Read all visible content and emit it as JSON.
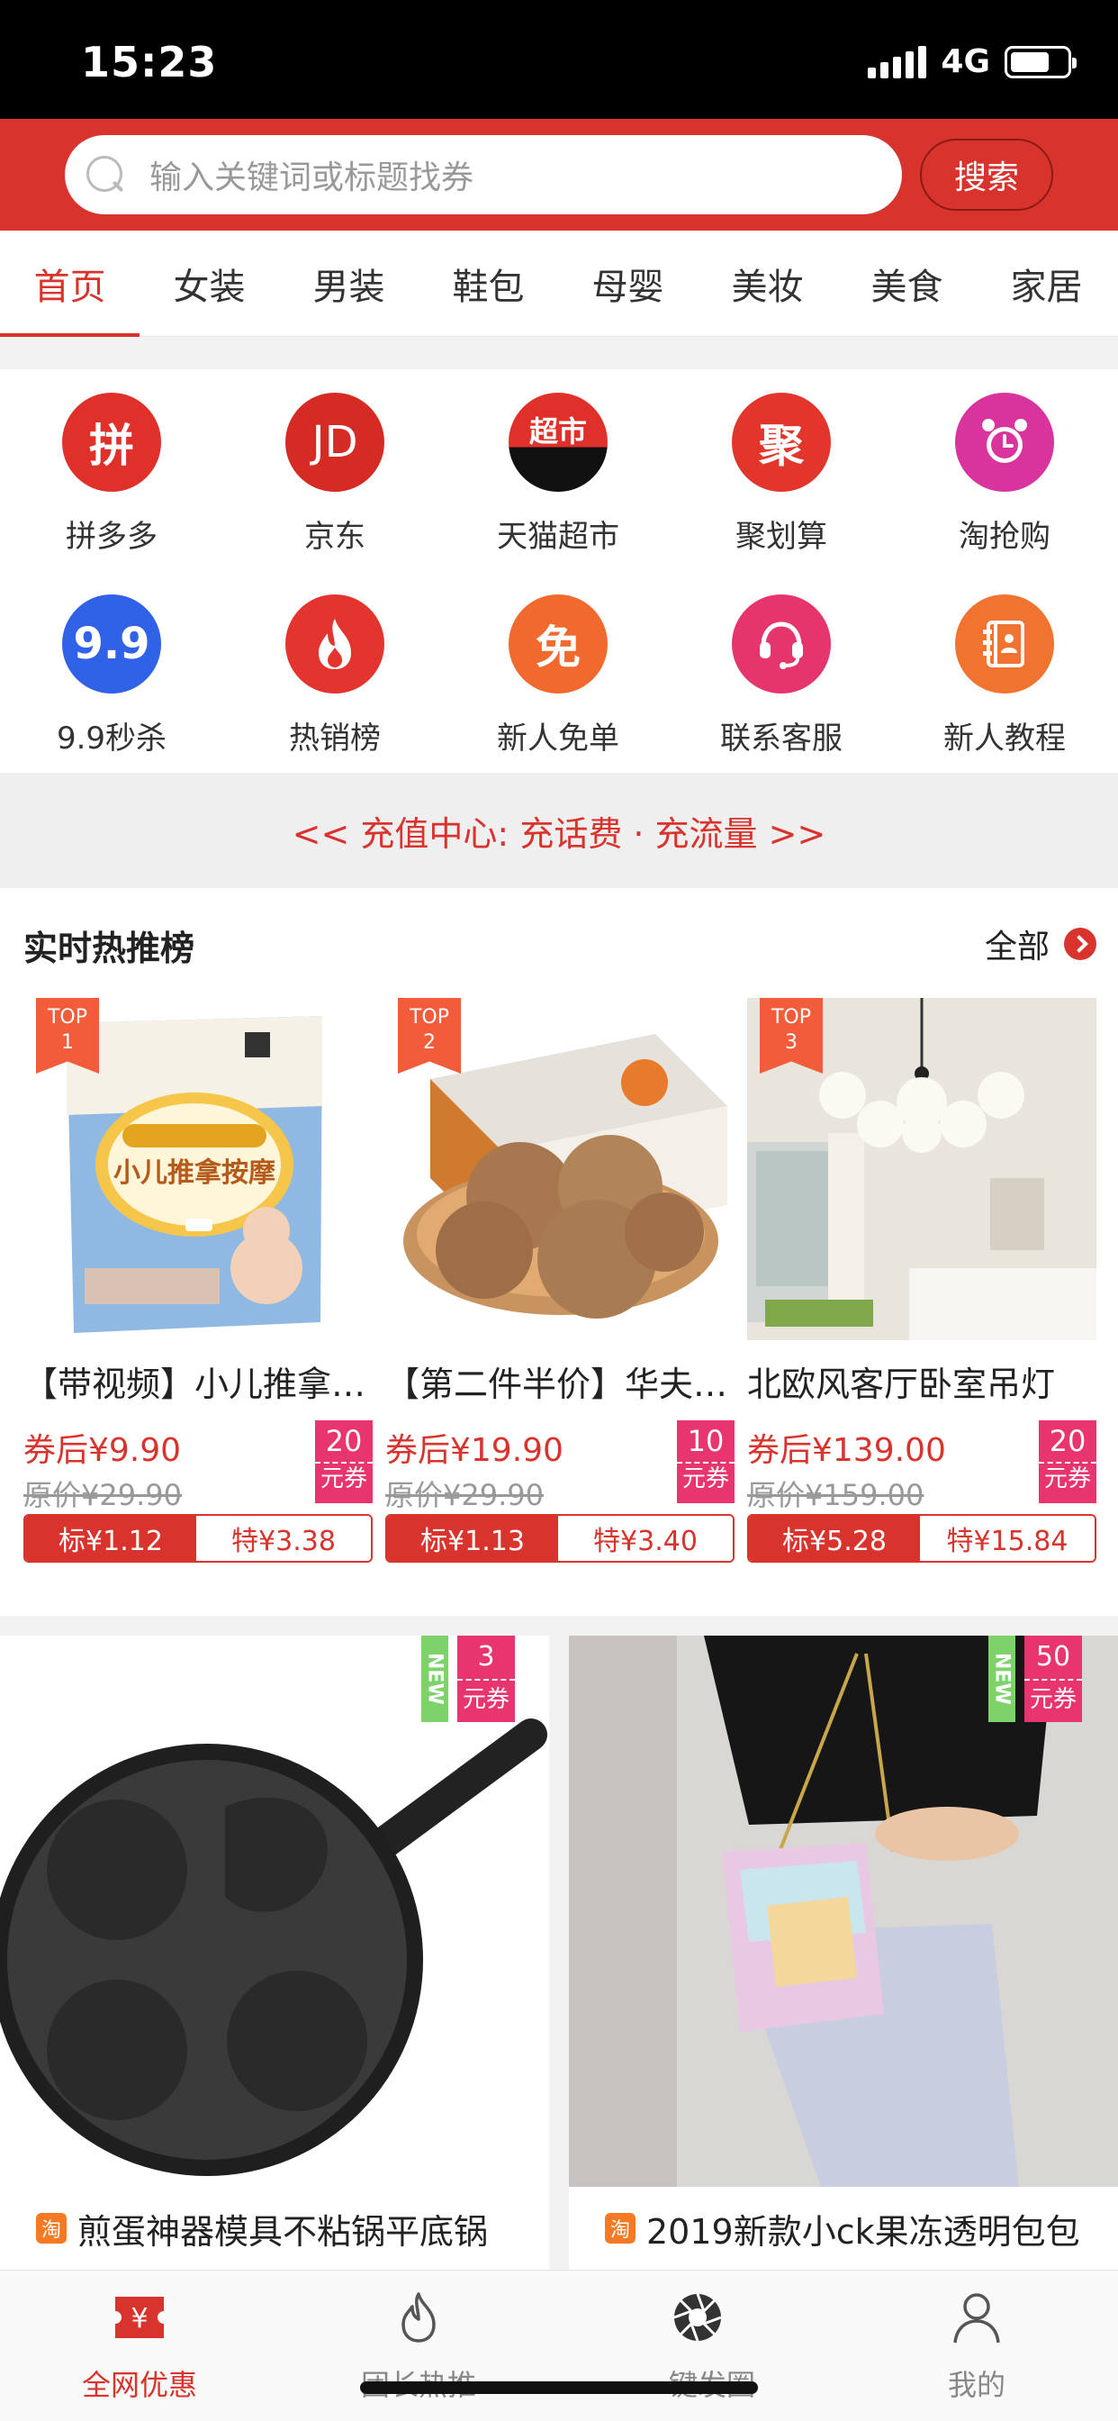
{
  "status_bar": {
    "time": "15:23",
    "network": "4G",
    "battery_level": 0.7
  },
  "search": {
    "placeholder": "输入关键词或标题找券",
    "button_label": "搜索"
  },
  "categories": [
    "首页",
    "女装",
    "男装",
    "鞋包",
    "母婴",
    "美妆",
    "美食",
    "家居"
  ],
  "active_category": "首页",
  "shortcuts": [
    {
      "label": "拼多多",
      "icon": "pinduoduo-icon",
      "glyph": "拼",
      "color": "#e0302a"
    },
    {
      "label": "京东",
      "icon": "jd-icon",
      "glyph": "JD",
      "color": "#d62a25"
    },
    {
      "label": "天猫超市",
      "icon": "tmall-supermarket-icon",
      "glyph": "超市",
      "color": "#111111"
    },
    {
      "label": "聚划算",
      "icon": "juhuasuan-icon",
      "glyph": "聚",
      "color": "#e2362c"
    },
    {
      "label": "淘抢购",
      "icon": "alarm-clock-icon",
      "glyph": "⏰",
      "color": "#d9339e"
    },
    {
      "label": "9.9秒杀",
      "icon": "nine-nine-icon",
      "glyph": "9.9",
      "color": "#2f62e6"
    },
    {
      "label": "热销榜",
      "icon": "flame-icon",
      "glyph": "🔥",
      "color": "#e3352d"
    },
    {
      "label": "新人免单",
      "icon": "free-order-icon",
      "glyph": "免",
      "color": "#f0692d"
    },
    {
      "label": "联系客服",
      "icon": "customer-service-icon",
      "glyph": "☏",
      "color": "#e6356c"
    },
    {
      "label": "新人教程",
      "icon": "tutorial-book-icon",
      "glyph": "📔",
      "color": "#f07430"
    }
  ],
  "recharge_banner": "<< 充值中心: 充话费 · 充流量 >>",
  "hot_rank": {
    "title": "实时热推榜",
    "all_label": "全部",
    "items": [
      {
        "rank_label": "TOP",
        "rank": "1",
        "name": "【带视频】小儿推拿按摩",
        "after_price": "券后¥9.90",
        "original_price": "原价¥29.90",
        "coupon_amount": "20",
        "coupon_unit": "元券",
        "commission_standard": "标¥1.12",
        "commission_special": "特¥3.38"
      },
      {
        "rank_label": "TOP",
        "rank": "2",
        "name": "【第二件半价】华夫饼干",
        "after_price": "券后¥19.90",
        "original_price": "原价¥29.90",
        "coupon_amount": "10",
        "coupon_unit": "元券",
        "commission_standard": "标¥1.13",
        "commission_special": "特¥3.40"
      },
      {
        "rank_label": "TOP",
        "rank": "3",
        "name": "北欧风客厅卧室吊灯",
        "after_price": "券后¥139.00",
        "original_price": "原价¥159.00",
        "coupon_amount": "20",
        "coupon_unit": "元券",
        "commission_standard": "标¥5.28",
        "commission_special": "特¥15.84"
      }
    ]
  },
  "feed": [
    {
      "new_label": "NEW",
      "coupon_amount": "3",
      "coupon_unit": "元券",
      "platform_icon": "淘",
      "title": "煎蛋神器模具不粘锅平底锅"
    },
    {
      "new_label": "NEW",
      "coupon_amount": "50",
      "coupon_unit": "元券",
      "platform_icon": "淘",
      "title": "2019新款小ck果冻透明包包"
    }
  ],
  "tab_bar": {
    "tabs": [
      {
        "label": "全网优惠",
        "icon": "coupon-yen-icon",
        "active": true
      },
      {
        "label": "团长热推",
        "icon": "flame-outline-icon",
        "active": false
      },
      {
        "label": "一键发圈",
        "icon": "aperture-icon",
        "active": false
      },
      {
        "label": "我的",
        "icon": "person-icon",
        "active": false
      }
    ]
  },
  "colors": {
    "brand_red": "#d8332c",
    "coupon_pink": "#e8356f",
    "new_green": "#7dd36a"
  }
}
